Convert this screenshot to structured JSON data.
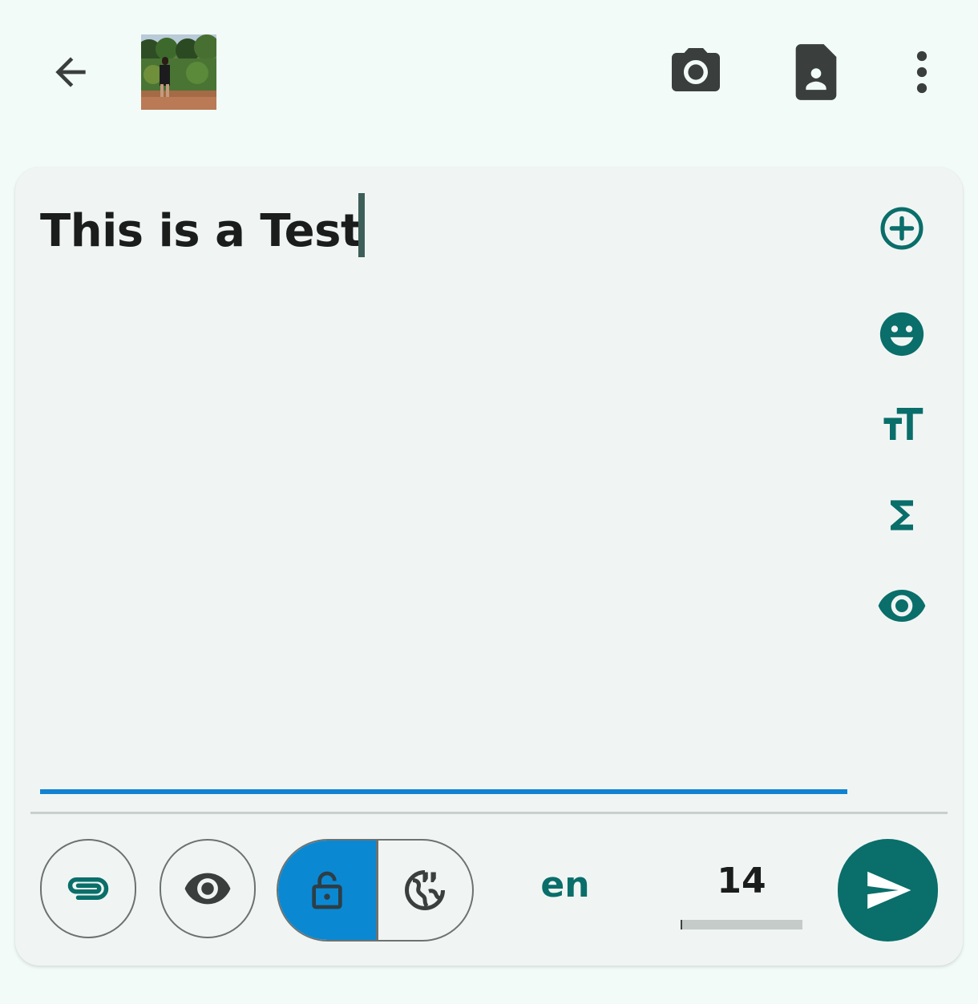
{
  "colors": {
    "background": "#f2fbf8",
    "card": "#f0f5f4",
    "accent_teal": "#0a6e6a",
    "accent_blue": "#0b88d2",
    "dark_icon": "#3a3f3e"
  },
  "toolbar": {
    "back_icon": "arrow-back-icon",
    "thumbnail": "attached-photo-thumbnail",
    "camera_icon": "camera-icon",
    "contact_icon": "contact-card-icon",
    "menu_icon": "more-vertical-icon"
  },
  "editor": {
    "text": "This is a Test"
  },
  "side_tools": [
    {
      "name": "add-circle-icon"
    },
    {
      "name": "emoji-icon"
    },
    {
      "name": "text-size-icon"
    },
    {
      "name": "sigma-icon"
    },
    {
      "name": "preview-eye-icon"
    }
  ],
  "bottom_bar": {
    "attach_icon": "paperclip-icon",
    "view_icon": "eye-icon",
    "lock_icon": "lock-open-icon",
    "public_icon": "public-globe-icon",
    "language": "en",
    "char_count": "14",
    "char_progress": 0.01,
    "send_icon": "send-icon"
  }
}
